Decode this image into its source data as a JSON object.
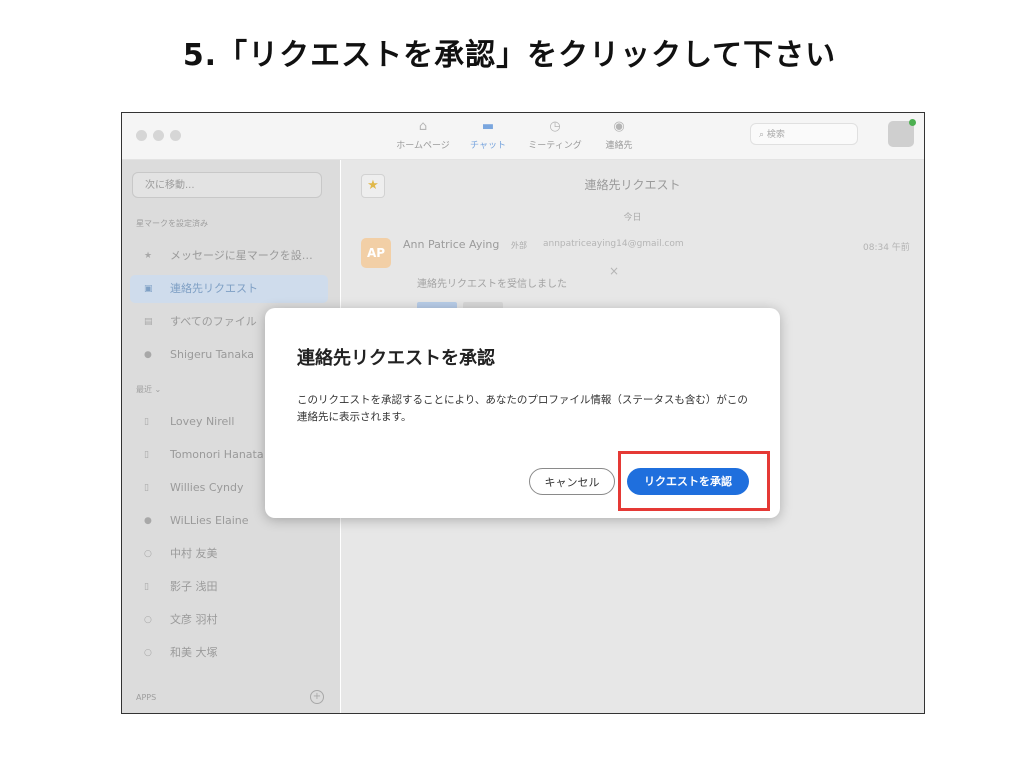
{
  "slide": {
    "title": "5.「リクエストを承認」をクリックして下さい"
  },
  "titlebar": {
    "nav": [
      {
        "label": "ホームページ",
        "icon": "home-icon"
      },
      {
        "label": "チャット",
        "icon": "chat-icon"
      },
      {
        "label": "ミーティング",
        "icon": "clock-icon"
      },
      {
        "label": "連絡先",
        "icon": "contacts-icon"
      }
    ],
    "search_placeholder": "検索"
  },
  "sidebar": {
    "jump_placeholder": "次に移動...",
    "starred_label": "星マークを設定済み",
    "items": [
      {
        "label": "メッセージに星マークを設…"
      },
      {
        "label": "連絡先リクエスト"
      },
      {
        "label": "すべてのファイル"
      },
      {
        "label": "Shigeru Tanaka"
      }
    ],
    "recent_label": "最近 ⌄",
    "recent": [
      {
        "label": "Lovey Nirell"
      },
      {
        "label": "Tomonori Hanata"
      },
      {
        "label": "Willies Cyndy"
      },
      {
        "label": "WiLLies Elaine"
      },
      {
        "label": "中村 友美"
      },
      {
        "label": "影子 浅田"
      },
      {
        "label": "文彦 羽村"
      },
      {
        "label": "和美 大塚"
      }
    ],
    "apps_label": "APPS"
  },
  "main": {
    "title": "連絡先リクエスト",
    "date": "今日",
    "message": {
      "avatar": "AP",
      "name": "Ann Patrice Aying",
      "tag": "外部",
      "email": "annpatriceaying14@gmail.com",
      "time": "08:34 午前",
      "text": "連絡先リクエストを受信しました"
    }
  },
  "dialog": {
    "title": "連絡先リクエストを承認",
    "body": "このリクエストを承認することにより、あなたのプロファイル情報（ステータスも含む）がこの連絡先に表示されます。",
    "cancel": "キャンセル",
    "accept": "リクエストを承認"
  },
  "colors": {
    "accent": "#1f6fdd",
    "highlight": "#e53935"
  }
}
